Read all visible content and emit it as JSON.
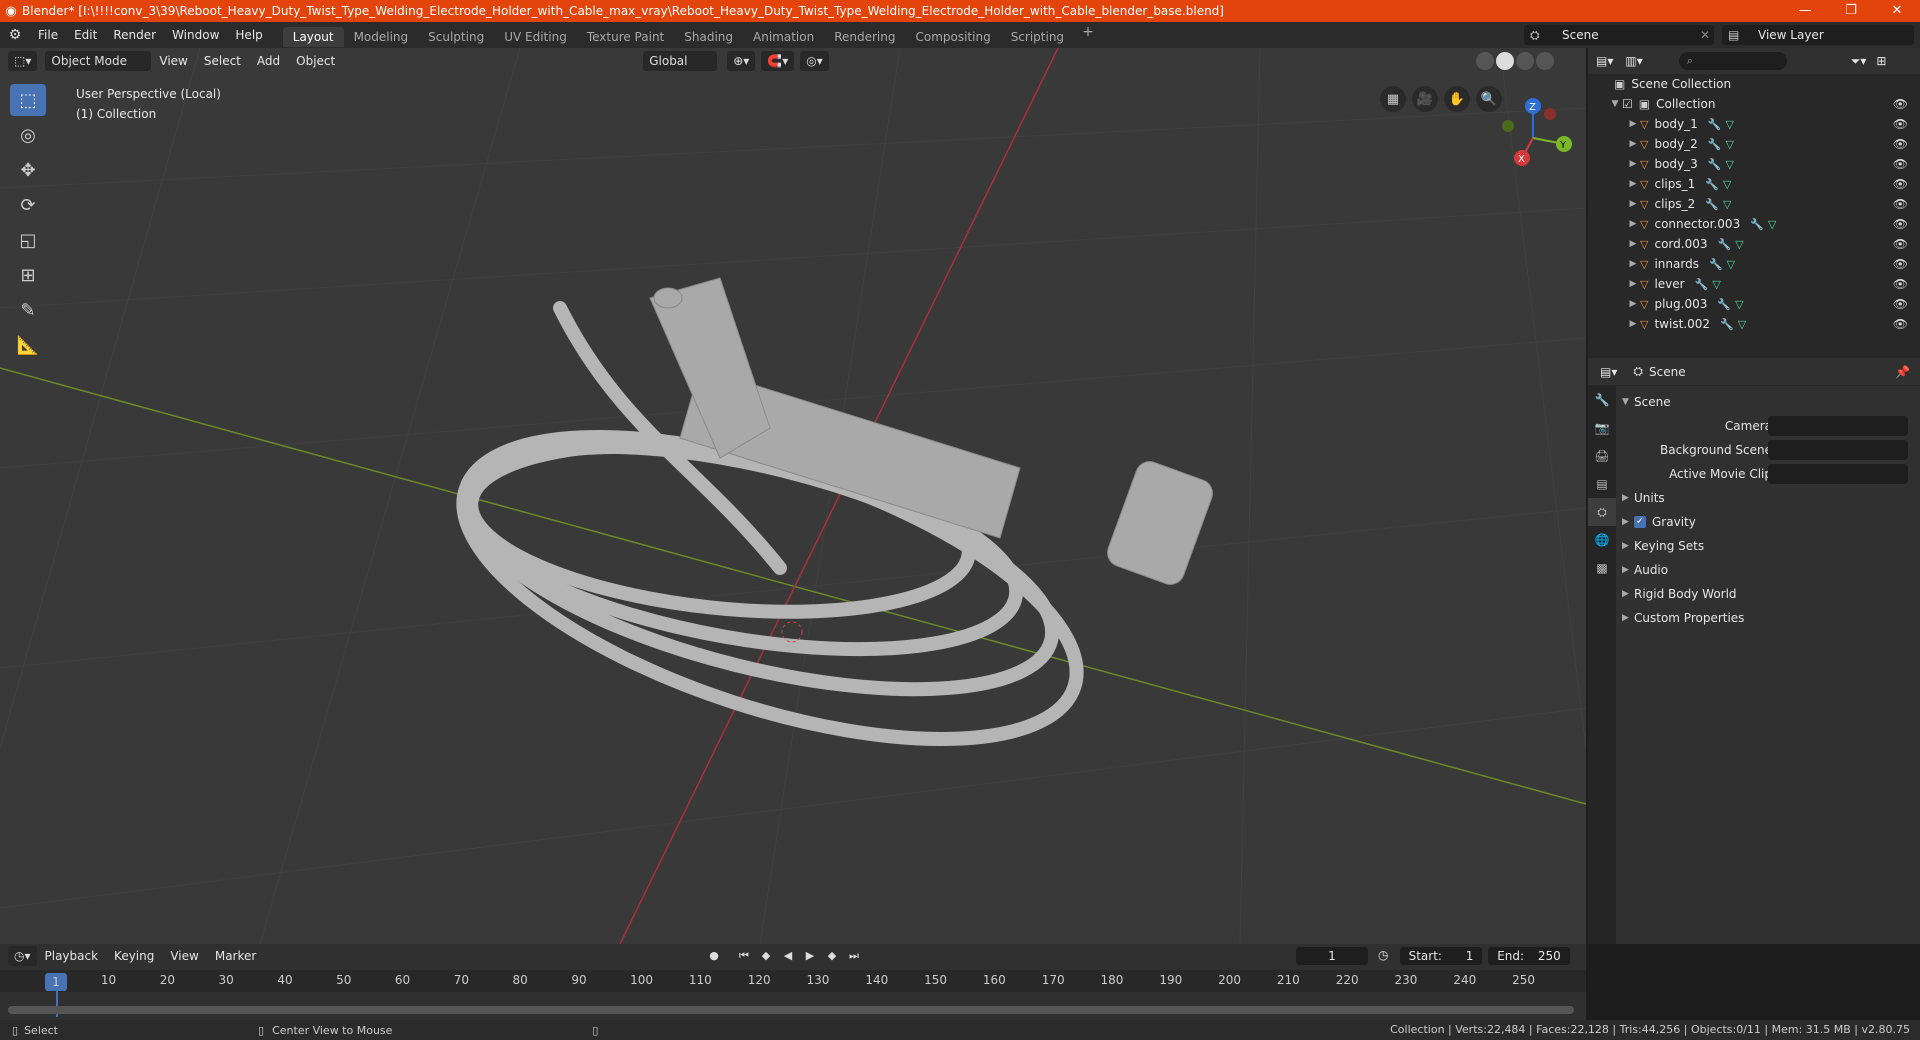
{
  "titlebar": {
    "title": "Blender* [I:\\!!!!conv_3\\39\\Reboot_Heavy_Duty_Twist_Type_Welding_Electrode_Holder_with_Cable_max_vray\\Reboot_Heavy_Duty_Twist_Type_Welding_Electrode_Holder_with_Cable_blender_base.blend]",
    "min": "—",
    "max": "❐",
    "close": "✕"
  },
  "menu": [
    "File",
    "Edit",
    "Render",
    "Window",
    "Help"
  ],
  "workspaces": [
    "Layout",
    "Modeling",
    "Sculpting",
    "UV Editing",
    "Texture Paint",
    "Shading",
    "Animation",
    "Rendering",
    "Compositing",
    "Scripting"
  ],
  "active_workspace": "Layout",
  "scene_name": "Scene",
  "view_layer": "View Layer",
  "viewport": {
    "mode": "Object Mode",
    "menus": [
      "View",
      "Select",
      "Add",
      "Object"
    ],
    "orientation": "Global",
    "perspective": "User Perspective (Local)",
    "collection": "(1) Collection",
    "gizmo": {
      "x": "X",
      "y": "Y",
      "z": "Z"
    }
  },
  "outliner": {
    "root": "Scene Collection",
    "collection": "Collection",
    "objects": [
      "body_1",
      "body_2",
      "body_3",
      "clips_1",
      "clips_2",
      "connector.003",
      "cord.003",
      "innards",
      "lever",
      "plug.003",
      "twist.002"
    ]
  },
  "properties": {
    "context": "Scene",
    "panel": "Scene",
    "fields": [
      "Camera",
      "Background Scene",
      "Active Movie Clip"
    ],
    "subpanels": [
      "Units",
      "Gravity",
      "Keying Sets",
      "Audio",
      "Rigid Body World",
      "Custom Properties"
    ]
  },
  "timeline": {
    "menus": [
      "Playback",
      "Keying",
      "View",
      "Marker"
    ],
    "current_frame": "1",
    "start_label": "Start:",
    "start": "1",
    "end_label": "End:",
    "end": "250",
    "ruler": [
      "1",
      "10",
      "20",
      "30",
      "40",
      "50",
      "60",
      "70",
      "80",
      "90",
      "100",
      "110",
      "120",
      "130",
      "140",
      "150",
      "160",
      "170",
      "180",
      "190",
      "200",
      "210",
      "220",
      "230",
      "240",
      "250"
    ]
  },
  "status": {
    "left": "Select",
    "middle": "Center View to Mouse",
    "stats": "Collection | Verts:22,484 | Faces:22,128 | Tris:44,256 | Objects:0/11 | Mem: 31.5 MB | v2.80.75"
  }
}
